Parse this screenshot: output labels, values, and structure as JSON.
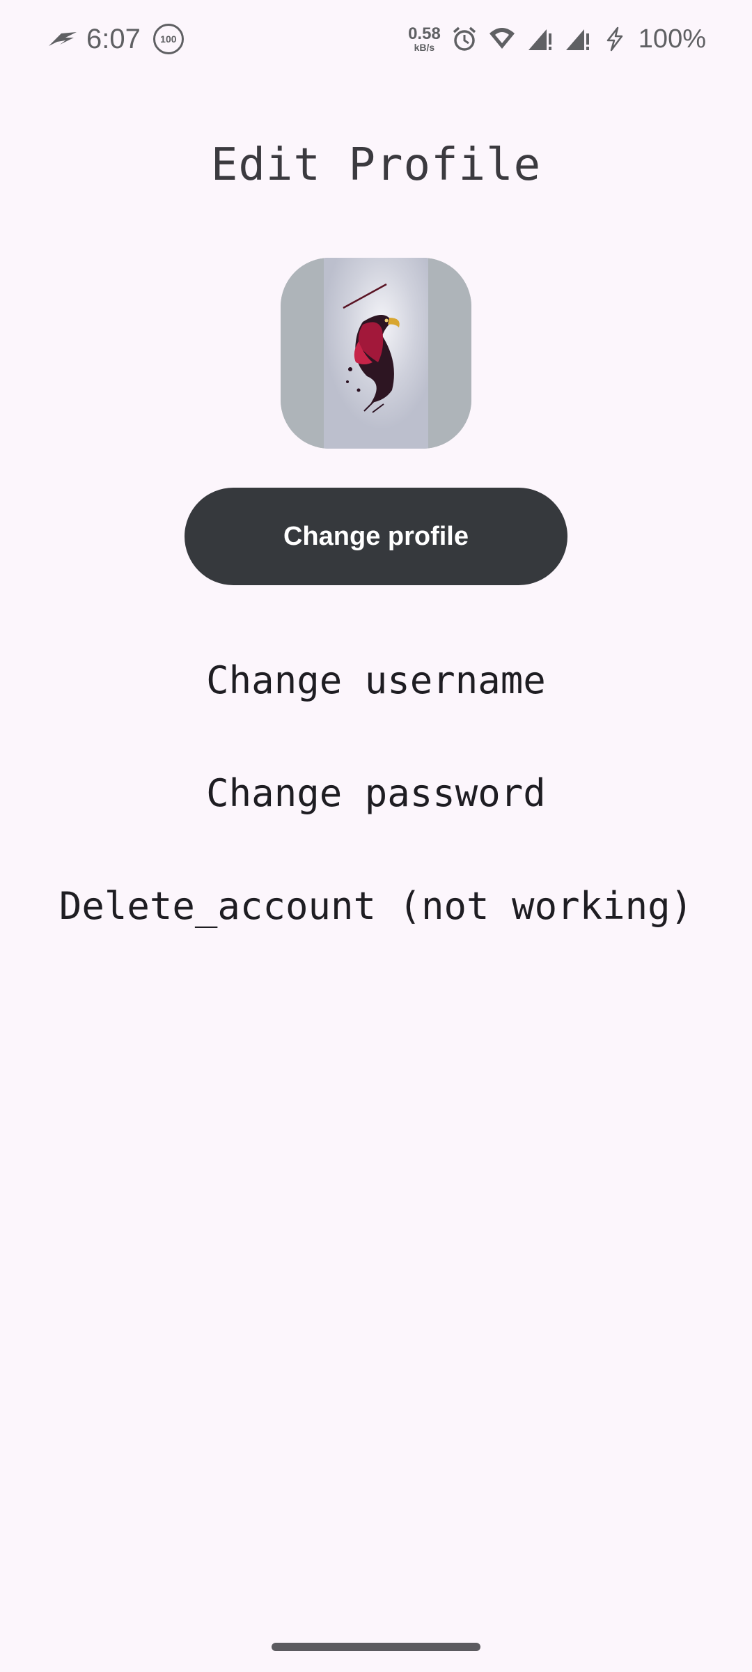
{
  "status_bar": {
    "time": "6:07",
    "badge": "100",
    "speed_value": "0.58",
    "speed_unit": "kB/s",
    "battery": "100%",
    "icons": [
      "rog-icon",
      "alarm-icon",
      "wifi-icon",
      "signal-icon",
      "signal-icon",
      "charging-icon"
    ]
  },
  "page": {
    "title": "Edit Profile"
  },
  "profile": {
    "change_profile_label": "Change profile"
  },
  "menu": {
    "change_username": "Change username",
    "change_password": "Change password",
    "delete_account": "Delete_account (not working)"
  },
  "colors": {
    "background": "#fcf6fc",
    "button": "#36393d",
    "text": "#1e1d22"
  }
}
